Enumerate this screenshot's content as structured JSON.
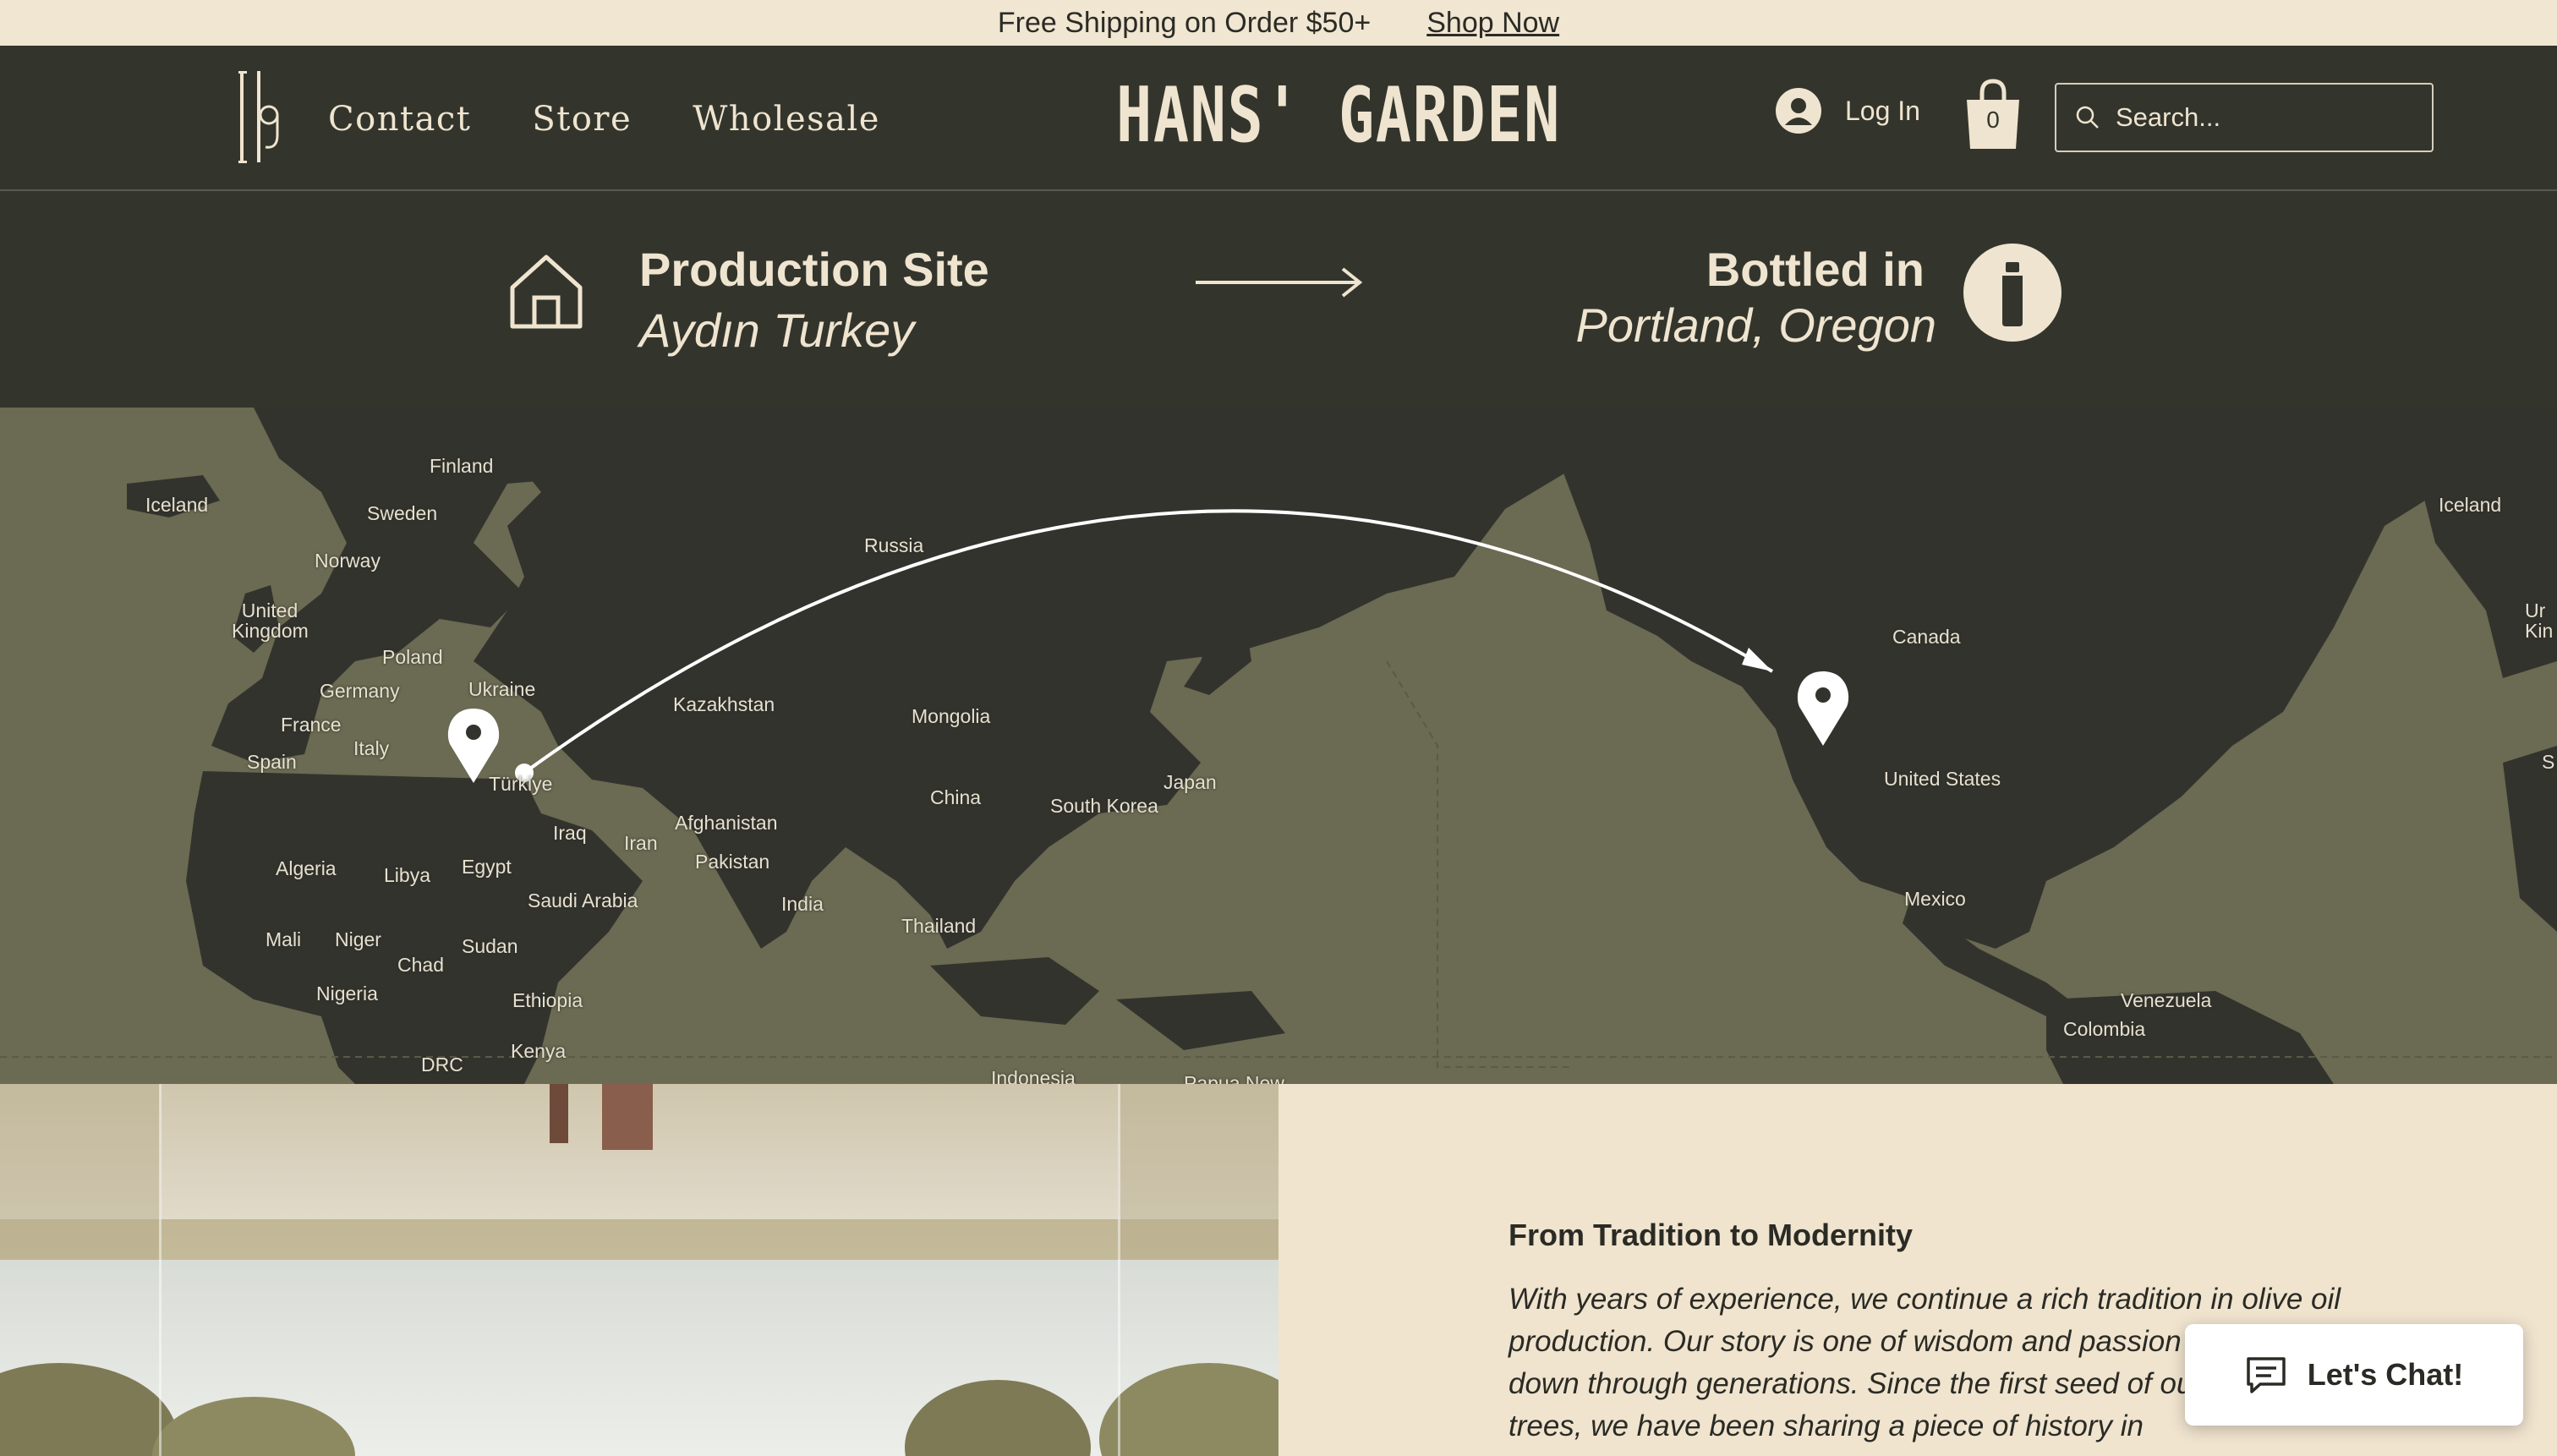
{
  "announcement": {
    "text": "Free Shipping on Order $50+",
    "link": "Shop Now"
  },
  "header": {
    "nav": [
      "Contact",
      "Store",
      "Wholesale"
    ],
    "brand": "HANS' GARDEN",
    "login": "Log In",
    "cart_count": "0",
    "search_placeholder": "Search..."
  },
  "route": {
    "production_title": "Production Site",
    "production_location": "Aydın Turkey",
    "bottled_title": "Bottled in",
    "bottled_location": "Portland, Oregon"
  },
  "map_labels": {
    "iceland_left": "Iceland",
    "finland": "Finland",
    "sweden": "Sweden",
    "norway": "Norway",
    "united_kingdom": "United Kingdom",
    "poland": "Poland",
    "germany": "Germany",
    "ukraine": "Ukraine",
    "france": "France",
    "italy": "Italy",
    "spain": "Spain",
    "turkiye": "Türkiye",
    "russia": "Russia",
    "kazakhstan": "Kazakhstan",
    "mongolia": "Mongolia",
    "china": "China",
    "south_korea": "South Korea",
    "japan": "Japan",
    "iraq": "Iraq",
    "iran": "Iran",
    "afghanistan": "Afghanistan",
    "pakistan": "Pakistan",
    "india": "India",
    "thailand": "Thailand",
    "indonesia": "Indonesia",
    "papua": "Papua New",
    "algeria": "Algeria",
    "libya": "Libya",
    "egypt": "Egypt",
    "saudi_arabia": "Saudi Arabia",
    "mali": "Mali",
    "niger": "Niger",
    "chad": "Chad",
    "sudan": "Sudan",
    "nigeria": "Nigeria",
    "ethiopia": "Ethiopia",
    "drc": "DRC",
    "kenya": "Kenya",
    "canada": "Canada",
    "united_states": "United States",
    "mexico": "Mexico",
    "venezuela": "Venezuela",
    "colombia": "Colombia",
    "iceland_right": "Iceland",
    "uk_partial": "Ur Kin",
    "s_partial": "S"
  },
  "story": {
    "title": "From Tradition to Modernity",
    "body": "With years of experience, we continue a rich tradition in olive oil production. Our story is one of wisdom and passion passed down through generations. Since the first seed of our olive trees, we have been sharing a piece of history in"
  },
  "chat": {
    "label": "Let's Chat!"
  },
  "colors": {
    "dark": "#33352d",
    "cream": "#f0e6d2",
    "map_water": "#6b6a52",
    "map_land": "#33332e"
  }
}
